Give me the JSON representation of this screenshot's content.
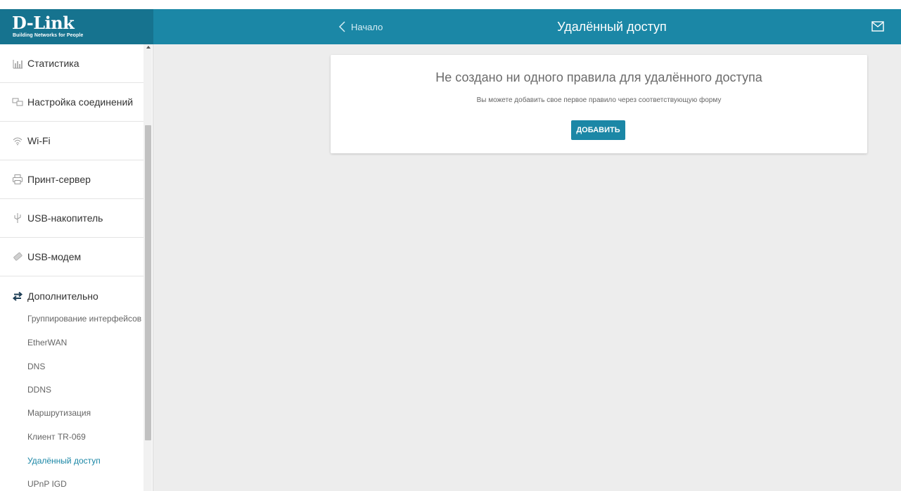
{
  "brand": {
    "logo": "D-Link",
    "tagline": "Building Networks for People"
  },
  "header": {
    "back_label": "Начало",
    "title": "Удалённый доступ",
    "mail_icon": "envelope-icon"
  },
  "sidebar": {
    "items": [
      {
        "label": "Статистика",
        "icon": "bar-chart-icon"
      },
      {
        "label": "Настройка соединений",
        "icon": "connections-icon"
      },
      {
        "label": "Wi-Fi",
        "icon": "wifi-icon"
      },
      {
        "label": "Принт-сервер",
        "icon": "printer-icon"
      },
      {
        "label": "USB-накопитель",
        "icon": "usb-icon"
      },
      {
        "label": "USB-модем",
        "icon": "usb-modem-icon"
      },
      {
        "label": "Дополнительно",
        "icon": "swap-arrows-icon"
      }
    ],
    "subitems": [
      "Группирование интерфейсов",
      "EtherWAN",
      "DNS",
      "DDNS",
      "Маршрутизация",
      "Клиент TR-069",
      "Удалённый доступ",
      "UPnP IGD"
    ],
    "active_subitem": "Удалённый доступ"
  },
  "main": {
    "empty_title": "Не создано ни одного правила для удалённого доступа",
    "empty_description": "Вы можете добавить свое первое правило через соответствующую форму",
    "add_button": "ДОБАВИТЬ"
  },
  "colors": {
    "header": "#1b87a6",
    "logo_bg": "#16738f",
    "background": "#ededed",
    "accent": "#1b87a6"
  }
}
